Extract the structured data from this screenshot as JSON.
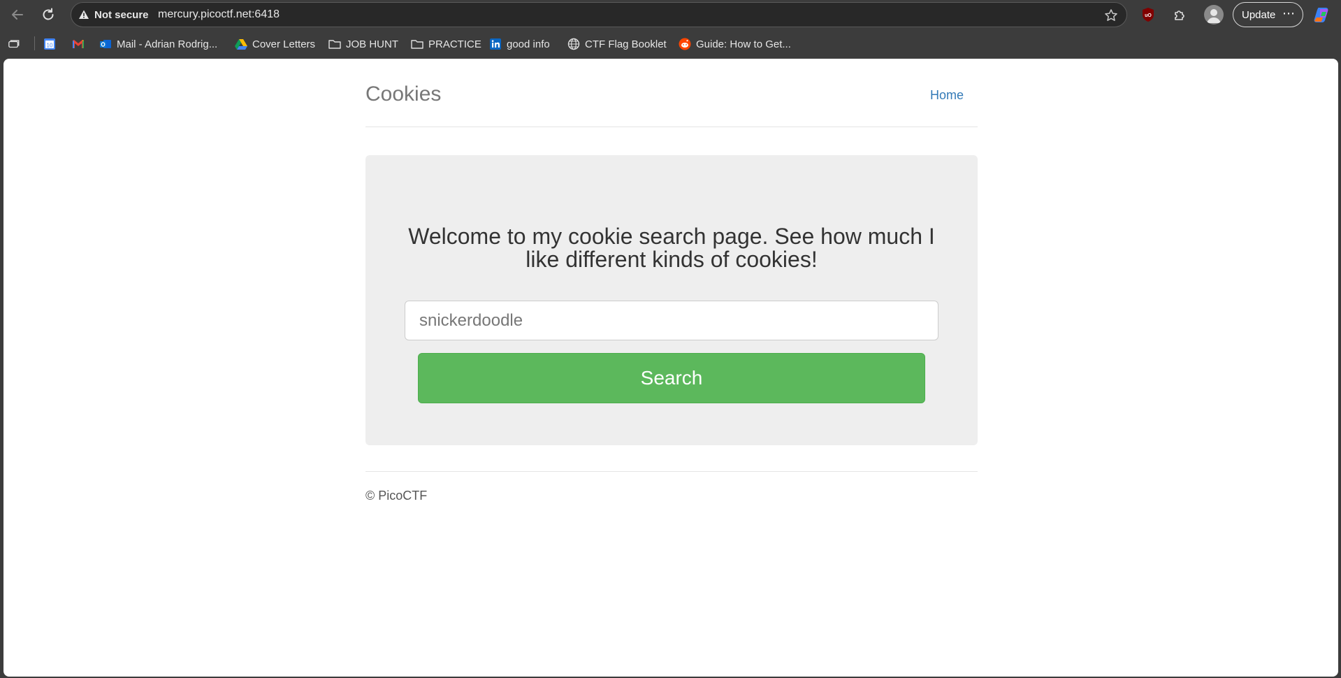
{
  "browser": {
    "security_label": "Not secure",
    "url": "mercury.picoctf.net:6418",
    "update_label": "Update",
    "more_glyph": "⋯",
    "accent_color": "#3c3c3c"
  },
  "bookmarks": [
    {
      "label": "",
      "icon": "calendar-icon"
    },
    {
      "label": "",
      "icon": "gmail-icon"
    },
    {
      "label": "Mail - Adrian Rodrig...",
      "icon": "outlook-icon"
    },
    {
      "label": "Cover Letters",
      "icon": "drive-icon"
    },
    {
      "label": "JOB HUNT",
      "icon": "folder-icon"
    },
    {
      "label": "PRACTICE",
      "icon": "folder-icon"
    },
    {
      "label": "good info",
      "icon": "linkedin-icon"
    },
    {
      "label": "CTF Flag Booklet",
      "icon": "globe-icon"
    },
    {
      "label": "Guide: How to Get...",
      "icon": "reddit-icon"
    }
  ],
  "calendar_day": "10",
  "page": {
    "title": "Cookies",
    "nav_home": "Home",
    "welcome": "Welcome to my cookie search page. See how much I like different kinds of cookies!",
    "search_placeholder": "snickerdoodle",
    "search_value": "",
    "search_button": "Search",
    "footer": "© PicoCTF",
    "button_color": "#5cb85c",
    "link_color": "#337ab7"
  }
}
